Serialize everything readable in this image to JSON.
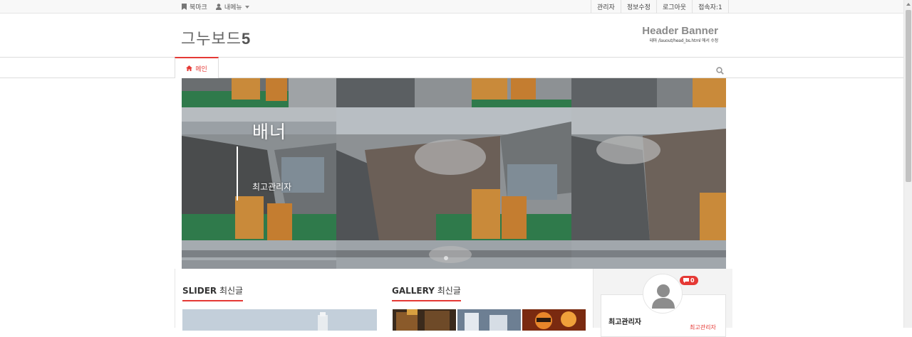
{
  "topbar": {
    "bookmark": "북마크",
    "mymenu": "내메뉴",
    "admin": "관리자",
    "edit_info": "정보수정",
    "logout": "로그아웃",
    "visitors": "접속자:1"
  },
  "header": {
    "logo_text": "그누보드",
    "logo_num": "5",
    "banner_title": "Header Banner",
    "banner_sub": "테마 /lauout/head_bs.html 에서 수정"
  },
  "nav": {
    "home_label": "메인"
  },
  "banner": {
    "title": "배너",
    "author": "최고관리자"
  },
  "sections": {
    "slider_title_en": "SLIDER",
    "slider_title_ko": " 최신글",
    "gallery_title_en": "GALLERY",
    "gallery_title_ko": " 최신글"
  },
  "sidebar": {
    "memo_count": "0",
    "profile_name": "최고관리자",
    "profile_link": "최고관리자"
  },
  "colors": {
    "accent": "#e53935"
  }
}
